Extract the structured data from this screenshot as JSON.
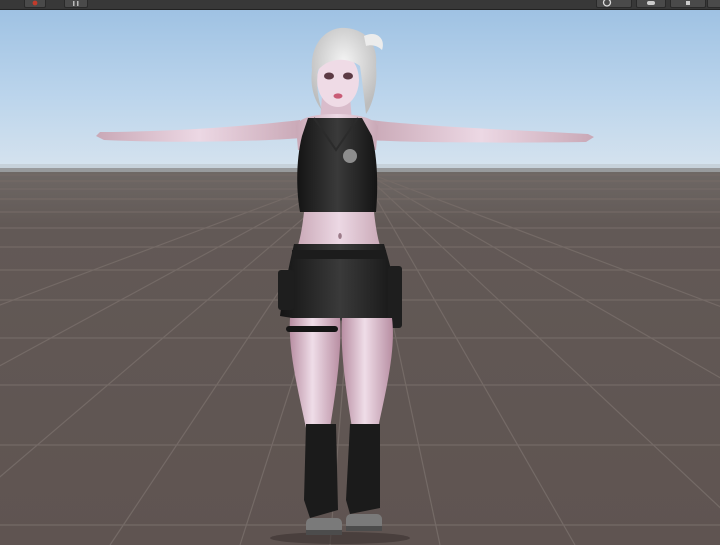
{
  "scene_view": {
    "toolbar": {
      "buttons": [
        {
          "icon": "unity-logo-icon"
        },
        {
          "icon": "layers-icon"
        },
        {
          "icon": "collab-icon"
        },
        {
          "icon": "cloud-icon"
        },
        {
          "icon": "account-icon"
        }
      ]
    },
    "viewport": {
      "sky_color": "#b7d2ec",
      "horizon_color": "#cfe0ef",
      "ground_color": "#645a56",
      "grid_color": "#756b66",
      "subject": "avatar-model-t-pose"
    }
  }
}
